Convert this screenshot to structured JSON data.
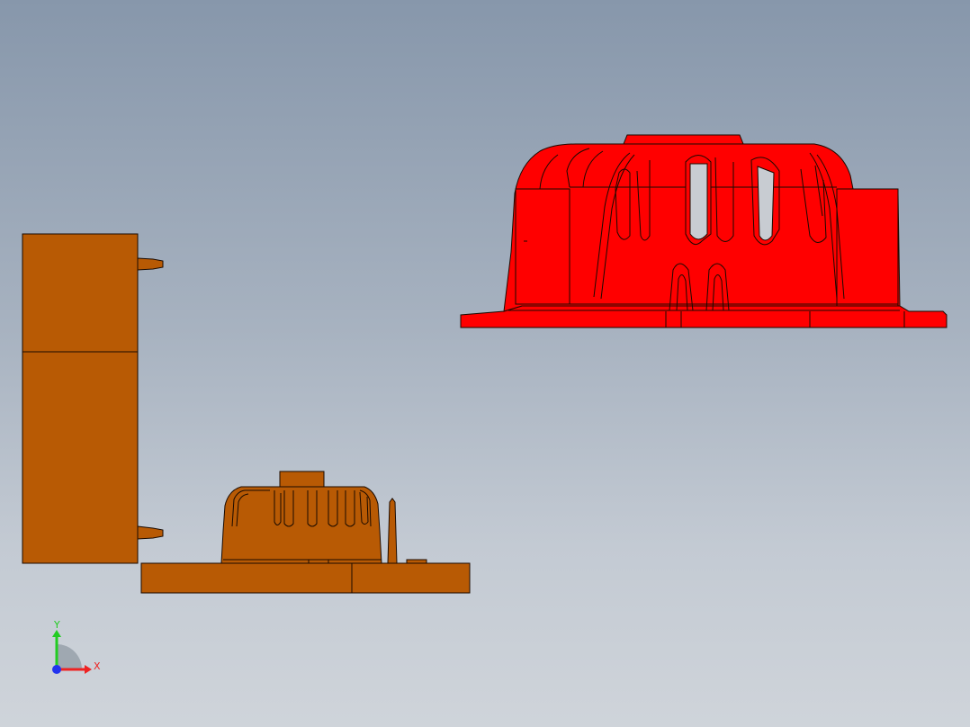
{
  "viewport": {
    "background_top": "#8797ab",
    "background_bottom": "#cfd4da"
  },
  "colors": {
    "mold_part": "#b85a04",
    "highlighted_part": "#ff0000",
    "edge": "#1a0a00"
  },
  "triad": {
    "y_label": "Y",
    "x_label": "X",
    "y_color": "#22cc22",
    "x_color": "#ee2222",
    "z_color": "#2233ee"
  }
}
